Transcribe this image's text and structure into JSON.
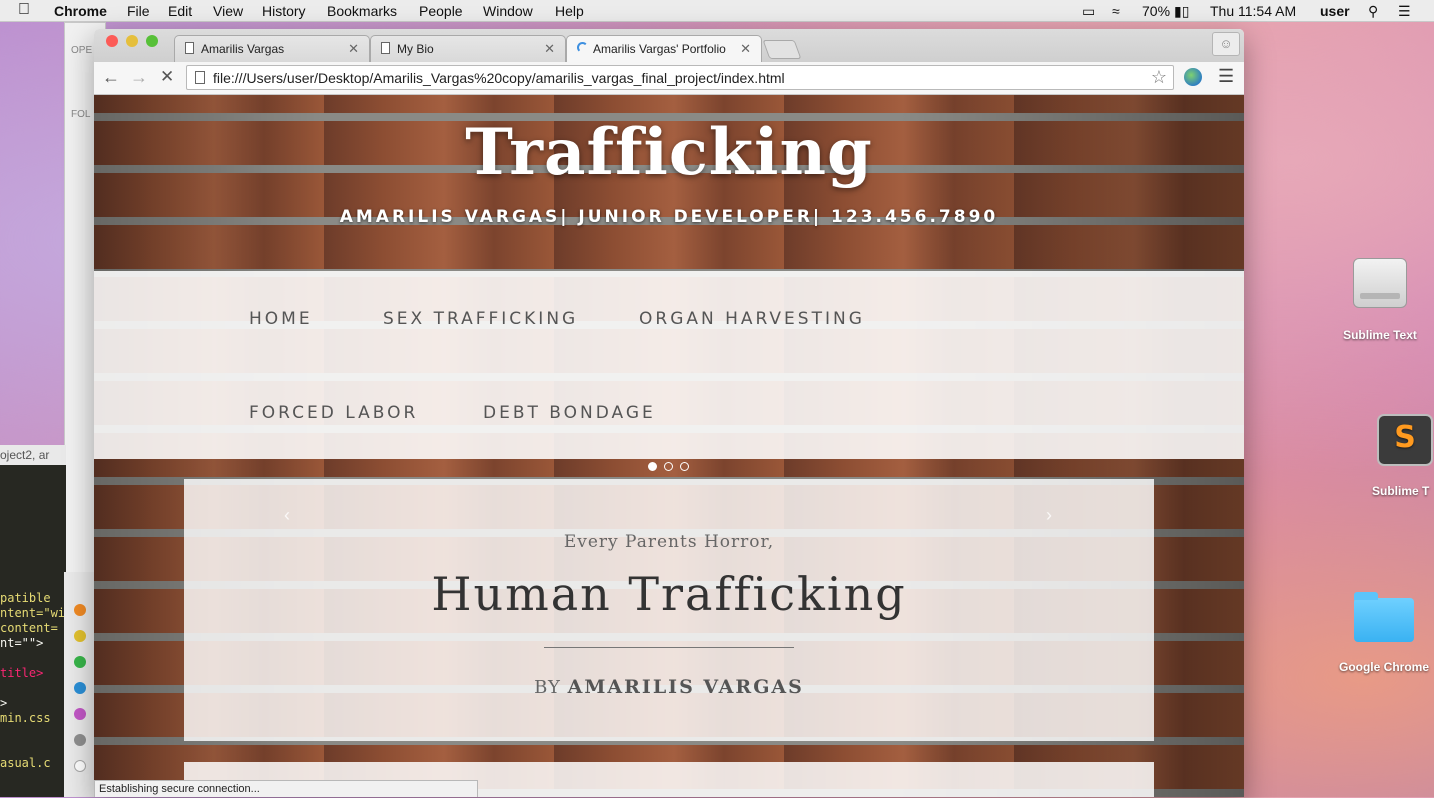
{
  "menubar": {
    "app": "Chrome",
    "items": [
      "File",
      "Edit",
      "View",
      "History",
      "Bookmarks",
      "People",
      "Window",
      "Help"
    ],
    "battery": "70%",
    "clock": "Thu 11:54 AM",
    "user": "user"
  },
  "desktop": {
    "icons": [
      "Sublime Text",
      "Sublime T",
      "Google Chrome"
    ],
    "bg_fragments": [
      "OPE",
      "FOL",
      "oject2, ar"
    ]
  },
  "code_lines": [
    "patible",
    "ntent=\"wi",
    "content=",
    "nt=\"\">",
    "title>",
    ">",
    "min.css",
    "asual.c"
  ],
  "browser": {
    "tabs": [
      {
        "title": "Amarilis Vargas",
        "active": false
      },
      {
        "title": "My Bio",
        "active": false
      },
      {
        "title": "Amarilis Vargas' Portfolio",
        "active": true
      }
    ],
    "url": "file:///Users/user/Desktop/Amarilis_Vargas%20copy/amarilis_vargas_final_project/index.html",
    "status": "Establishing secure connection..."
  },
  "page": {
    "title": "Trafficking",
    "subtitle": "AMARILIS VARGAS| JUNIOR DEVELOPER| 123.456.7890",
    "nav": [
      "HOME",
      "SEX TRAFFICKING",
      "ORGAN HARVESTING",
      "FORCED LABOR",
      "DEBT BONDAGE"
    ],
    "hero": {
      "pre": "Every Parents Horror,",
      "heading": "Human Trafficking",
      "by_prefix": "BY",
      "by_name": "AMARILIS VARGAS"
    },
    "carousel": {
      "count": 3,
      "active_index": 0
    }
  },
  "colors": {
    "close": "#fc5b57",
    "minimize": "#e5bf3c",
    "zoom": "#57c038",
    "spinner": "#3d8fe0"
  }
}
